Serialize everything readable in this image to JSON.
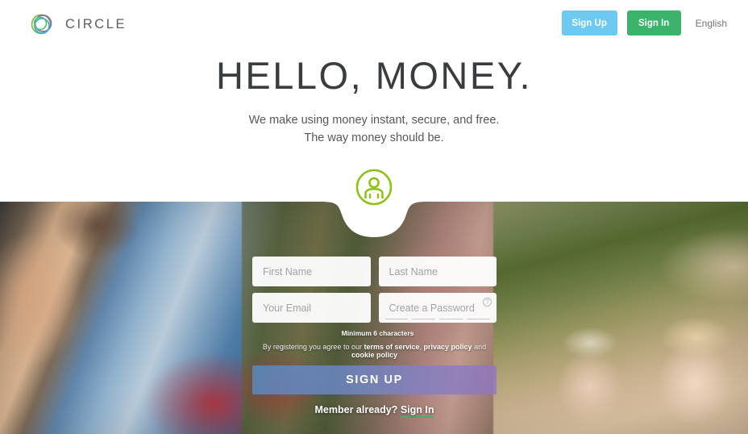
{
  "header": {
    "brand_name": "CIRCLE",
    "logo_icon": "circle-swirl-logo",
    "signup_label": "Sign Up",
    "signin_label": "Sign In",
    "language_label": "English",
    "signup_color": "#6ec9f0",
    "signin_color": "#3cb36b"
  },
  "hero": {
    "headline": "HELLO, MONEY.",
    "subline_1": "We make using money instant, secure, and free.",
    "subline_2": "The way money should be."
  },
  "avatar": {
    "icon": "person-avatar-icon",
    "color": "#8cc517"
  },
  "form": {
    "first_name_placeholder": "First Name",
    "last_name_placeholder": "Last Name",
    "email_placeholder": "Your Email",
    "password_placeholder": "Create a Password",
    "first_name_value": "",
    "last_name_value": "",
    "email_value": "",
    "password_value": "",
    "help_icon": "question-mark-icon",
    "password_hint": "Minimum 6 characters",
    "strength_segments": 4,
    "terms_prefix": "By registering you agree to our ",
    "terms_link_1": "terms of service",
    "terms_sep_1": ", ",
    "terms_link_2": "privacy policy",
    "terms_sep_2": " and ",
    "terms_link_3": "cookie policy",
    "submit_label": "SIGN UP",
    "member_prompt": "Member already? ",
    "member_link": "Sign In"
  }
}
